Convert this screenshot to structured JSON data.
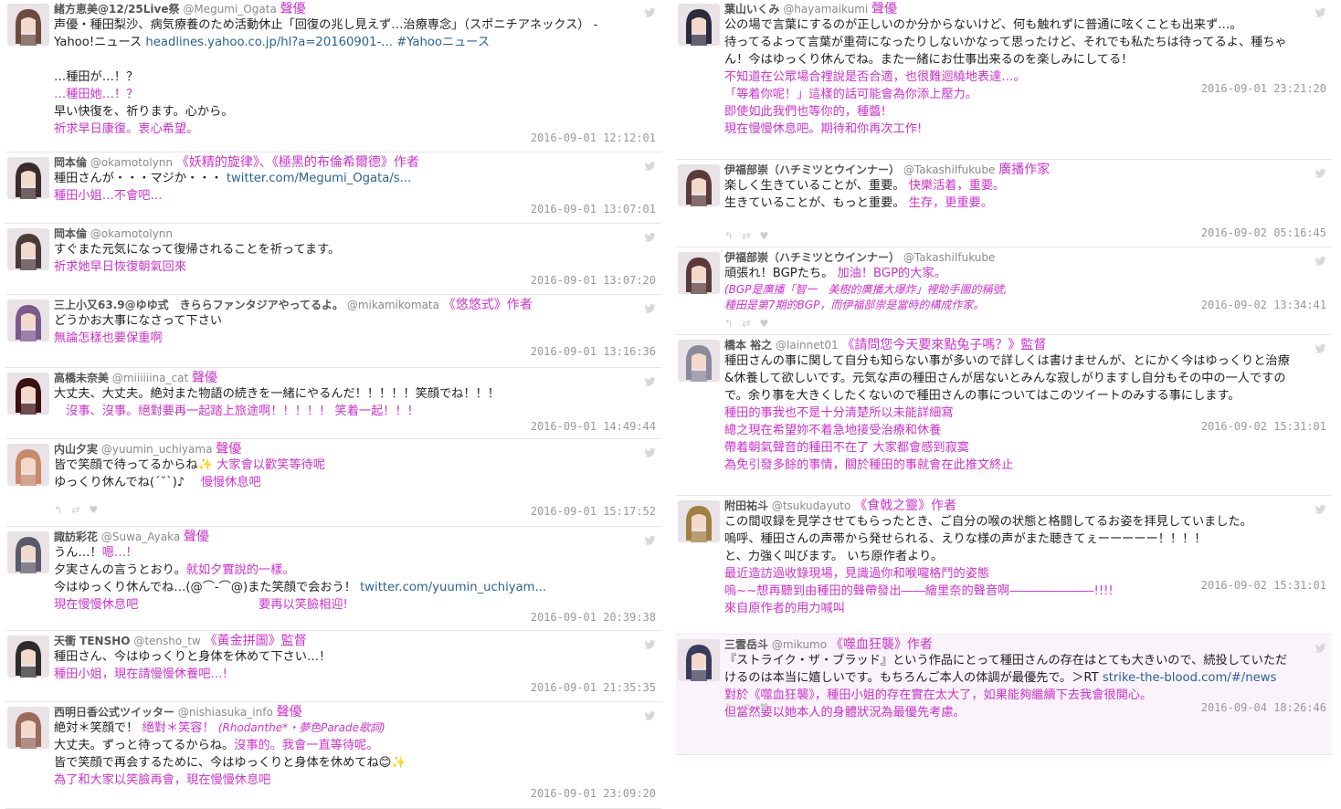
{
  "colors": {
    "translation": "#cc33cc",
    "link": "#2a6496",
    "timestamp": "#999999"
  },
  "left_column": [
    {
      "name": "緒方恵美@12/25Live祭",
      "handle": "@Megumi_Ogata",
      "role": "聲優",
      "avatar_icon": "avatar-icon",
      "lines": [
        {
          "text": "声優・種田梨沙、病気療養のため活動休止「回復の兆し見えず…治療専念」（スポニチアネックス） -",
          "style": "jp"
        },
        {
          "text": "Yahoo!ニュース ",
          "link": "headlines.yahoo.co.jp/hl?a=20160901-... #Yahooニュース",
          "style": "jp"
        },
        {
          "text": "",
          "style": "jp"
        },
        {
          "text": "…種田が…！？",
          "style": "jp"
        },
        {
          "text": "…種田她…！？",
          "style": "tr"
        },
        {
          "text": "早い快復を、祈ります。心から。",
          "style": "jp"
        },
        {
          "text": "祈求早日康復。衷心希望。",
          "style": "tr"
        }
      ],
      "timestamp": "2016-09-01 12:12:01"
    },
    {
      "name": "岡本倫",
      "handle": "@okamotolynn",
      "role": "《妖精的旋律》、《極黑的布倫希爾德》作者",
      "avatar_icon": "avatar-icon",
      "lines": [
        {
          "text": "種田さんが・・・マジか・・・ ",
          "link": "twitter.com/Megumi_Ogata/s...",
          "style": "jp"
        },
        {
          "text": "種田小姐…不會吧…",
          "style": "tr"
        }
      ],
      "timestamp": "2016-09-01 13:07:01"
    },
    {
      "name": "岡本倫",
      "handle": "@okamotolynn",
      "role": "",
      "avatar_icon": "avatar-icon",
      "lines": [
        {
          "text": "すぐまた元気になって復帰されることを祈ってます。",
          "style": "jp"
        },
        {
          "text": " 祈求她早日恢復朝氣回來",
          "style": "tr"
        }
      ],
      "timestamp": "2016-09-01 13:07:20"
    },
    {
      "name": "三上小又63.9@ゆゆ式　きららファンタジアやってるよ。",
      "handle": "@mikamikomata",
      "role": "《悠悠式》作者",
      "avatar_icon": "avatar-icon",
      "lines": [
        {
          "text": "どうかお大事になさって下さい",
          "style": "jp"
        },
        {
          "text": "無論怎樣也要保重啊",
          "style": "tr"
        }
      ],
      "timestamp": "2016-09-01 13:16:36"
    },
    {
      "name": "高橋未奈美",
      "handle": "@miiiiiina_cat",
      "role": "聲優",
      "avatar_icon": "avatar-icon",
      "lines": [
        {
          "text": "大丈夫、大丈夫。絶対また物語の続きを一緒にやるんだ！！！！！笑顔でね！！！",
          "style": "jp"
        },
        {
          "text": "　沒事、沒事。絕對要再一起踏上旅途啊！！！！！ 笑着一起！！！",
          "style": "tr"
        }
      ],
      "timestamp": "2016-09-01 14:49:44"
    },
    {
      "name": "内山夕実",
      "handle": "@yuumin_uchiyama",
      "role": "聲優",
      "avatar_icon": "avatar-icon",
      "lines": [
        {
          "text": "皆で笑顔で待ってるからね✨ ",
          "tr": " 大家會以歡笑等待呢",
          "style": "jp"
        },
        {
          "text": "ゆっくり休んでね(´˘`)♪ ",
          "tr": "　慢慢休息吧",
          "style": "jp"
        }
      ],
      "timestamp": "2016-09-01 15:17:52"
    },
    {
      "name": "諏訪彩花",
      "handle": "@Suwa_Ayaka",
      "role": "聲優",
      "avatar_icon": "avatar-icon",
      "lines": [
        {
          "text": "うん…！",
          "tr": "嗯…!",
          "style": "jp"
        },
        {
          "text": "夕実さんの言うとおり。",
          "tr": "就如夕實說的一樣。",
          "style": "jp"
        },
        {
          "text": "今はゆっくり休んでね…(@⌒‐⌒@)また笑顔で会おう！ ",
          "link": "twitter.com/yuumin_uchiyam...",
          "style": "jp"
        },
        {
          "text": "現在慢慢休息吧　　　　　　　　　　要再以笑臉相迎!",
          "style": "tr"
        }
      ],
      "timestamp": "2016-09-01 20:39:38"
    },
    {
      "name": "天衝 TENSHO",
      "handle": "@tensho_tw",
      "role": "《黃金拼圖》監督",
      "avatar_icon": "avatar-icon",
      "lines": [
        {
          "text": "種田さん、今はゆっくりと身体を休めて下さい…！",
          "style": "jp"
        },
        {
          "text": "種田小姐，現在請慢慢休養吧…!",
          "style": "tr"
        }
      ],
      "timestamp": "2016-09-01 21:35:35"
    },
    {
      "name": "西明日香公式ツイッター",
      "handle": "@nishiasuka_info",
      "role": "聲優",
      "avatar_icon": "avatar-icon",
      "lines": [
        {
          "text": "絶対＊笑顔で！ ",
          "tr": "絕對＊笑容！ ",
          "tr2": "(Rhodanthe*・夢色Parade歌詞)",
          "style": "jp"
        },
        {
          "text": "大丈夫。ずっと待ってるからね。",
          "tr": "沒事的。我會一直等待呢。",
          "style": "jp"
        },
        {
          "text": "皆で笑顔で再会するために、今はゆっくりと身体を休めてね😊✨",
          "style": "jp"
        },
        {
          "text": "為了和大家以笑臉再會，現在慢慢休息吧",
          "style": "tr"
        }
      ],
      "timestamp": "2016-09-01 23:09:20"
    }
  ],
  "right_column": [
    {
      "name": "葉山いくみ",
      "handle": "@hayamaikumi",
      "role": "聲優",
      "avatar_icon": "avatar-icon",
      "lines": [
        {
          "text": "公の場で言葉にするのが正しいのか分からないけど、何も触れずに普通に呟くことも出来ず…。",
          "style": "jp"
        },
        {
          "text": "待ってるよって言葉が重荷になったりしないかなって思ったけど、それでも私たちは待ってるよ、種ちゃ",
          "style": "jp"
        },
        {
          "text": "ん！今はゆっくり休んでね。また一緒にお仕事出来るのを楽しみにしてる！",
          "style": "jp"
        },
        {
          "text": "不知道在公眾場合裡說是否合適，也很難迴繞地表達…。",
          "style": "tr"
        },
        {
          "text": "「等着你呢！」這樣的話可能會為你添上壓力。",
          "style": "tr"
        },
        {
          "text": "即使如此我們也等你的，種醬!",
          "style": "tr"
        },
        {
          "text": "現在慢慢休息吧。期待和你再次工作!",
          "style": "tr"
        }
      ],
      "timestamp": "2016-09-01 23:21:20"
    },
    {
      "name": "伊福部崇（ハチミツとウインナー）",
      "handle": "@TakashiIfukube",
      "role": "廣播作家",
      "avatar_icon": "avatar-icon",
      "lines": [
        {
          "text": "楽しく生きていることが、重要。 ",
          "tr": "快樂活着，重要。",
          "style": "jp"
        },
        {
          "text": "生きていることが、もっと重要。 ",
          "tr": "生存，更重要。",
          "style": "jp"
        }
      ],
      "timestamp": "2016-09-02 05:16:45"
    },
    {
      "name": "伊福部崇（ハチミツとウインナー）",
      "handle": "@TakashiIfukube",
      "role": "",
      "avatar_icon": "avatar-icon",
      "lines": [
        {
          "text": "頑張れ！BGPたち。 ",
          "tr": "加油！BGP的大家。",
          "style": "jp"
        },
        {
          "text": "(BGP是廣播「智一　美樹的廣播大爆炸」裡助手團的稱號,",
          "style": "trs"
        },
        {
          "text": "種田是第7期的BGP，而伊福部崇是當時的構成作家。",
          "style": "trs"
        }
      ],
      "timestamp": "2016-09-02 13:34:41"
    },
    {
      "name": "橋本 裕之",
      "handle": "@lainnet01",
      "role": "《請問您今天要來點兔子嗎？》監督",
      "avatar_icon": "avatar-icon",
      "lines": [
        {
          "text": "種田さんの事に関して自分も知らない事が多いので詳しくは書けませんが、とにかく今はゆっくりと治療",
          "style": "jp"
        },
        {
          "text": "&休養して欲しいです。元気な声の種田さんが居ないとみんな寂しがりますし自分もその中の一人ですの",
          "style": "jp"
        },
        {
          "text": "で。余り事を大きくしたくないので種田さんの事についてはこのツイートのみする事にします。",
          "style": "jp"
        },
        {
          "text": "種田的事我也不是十分清楚所以未能詳細寫",
          "style": "tr"
        },
        {
          "text": "總之現在希望妳不着急地接受治療和休養",
          "style": "tr"
        },
        {
          "text": "帶着朝氣聲音的種田不在了 大家都會感到寂寞",
          "style": "tr"
        },
        {
          "text": "為免引發多餘的事情，關於種田的事就會在此推文終止",
          "style": "tr"
        }
      ],
      "timestamp": "2016-09-02 15:31:01"
    },
    {
      "name": "附田祐斗",
      "handle": "@tsukudayuto",
      "role": "《食戟之靈》作者",
      "avatar_icon": "avatar-icon",
      "lines": [
        {
          "text": "この間収録を見学させてもらったとき、ご自分の喉の状態と格闘してるお姿を拝見していました。",
          "style": "jp"
        },
        {
          "text": "嗚呼、種田さんの声帯から発せられる、えりな様の声がまた聴きてぇーーーーー！！！！",
          "style": "jp"
        },
        {
          "text": "と、力強く叫びます。 いち原作者より。",
          "style": "jp"
        },
        {
          "text": "最近造訪過收錄現場，見識過你和喉嚨格鬥的姿態",
          "style": "tr"
        },
        {
          "text": "嗚~~想再聽到由種田的聲帶發出――繪里奈的聲音啊―――――――!!!!",
          "style": "tr"
        },
        {
          "text": "來自原作者的用力喊叫",
          "style": "tr"
        }
      ],
      "timestamp": "2016-09-02 15:31:01"
    },
    {
      "name": "三雲岳斗",
      "handle": "@mikumo",
      "role": "《噬血狂襲》作者",
      "avatar_icon": "avatar-icon",
      "lines": [
        {
          "text": "『ストライク・ザ・ブラッド』という作品にとって種田さんの存在はとても大きいので、続投していただ",
          "style": "jp"
        },
        {
          "text": "けるのは本当に嬉しいです。もちろんご本人の体調が最優先で。＞RT ",
          "link": "strike-the-blood.com/#/news",
          "style": "jp"
        },
        {
          "text": "對於《噬血狂襲》，種田小姐的存在實在太大了，如果能夠繼續下去我會很開心。",
          "style": "tr"
        },
        {
          "text": "但當然要以她本人的身體狀況為最優先考慮。",
          "style": "tr"
        }
      ],
      "timestamp": "2016-09-04 18:26:46"
    }
  ]
}
